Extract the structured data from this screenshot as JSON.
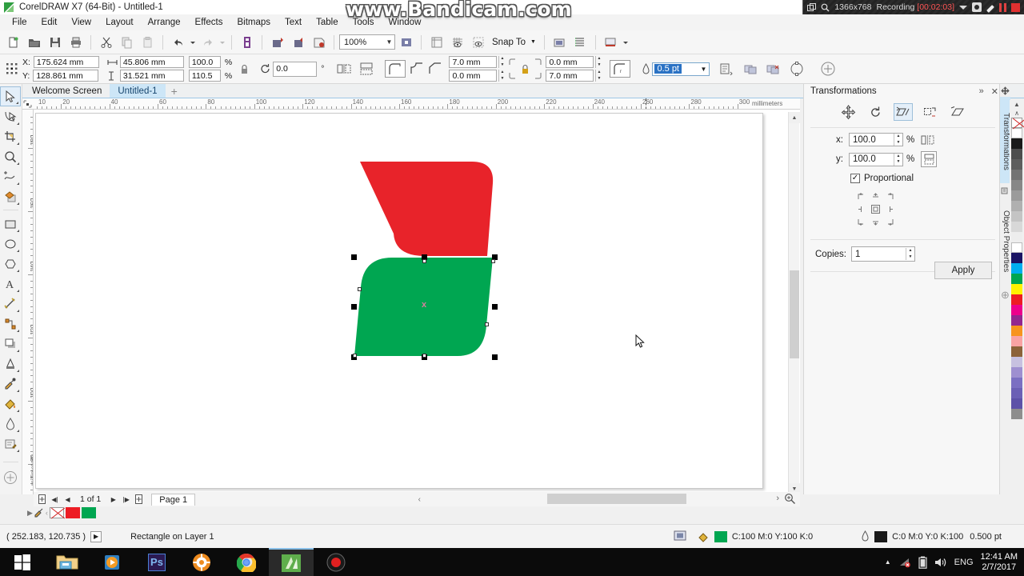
{
  "window": {
    "title": "CorelDRAW X7 (64-Bit) - Untitled-1",
    "app_icon": "coreldraw-icon"
  },
  "watermark": {
    "text": "www.Bandicam.com"
  },
  "recording_bar": {
    "resolution": "1366x768",
    "status_label": "Recording",
    "timer": "[00:02:03]",
    "icons": [
      "window-target-icon",
      "magnifier-icon",
      "caret-down-icon",
      "camera-icon",
      "pencil-icon",
      "pause-icon",
      "stop-icon"
    ]
  },
  "menu": {
    "items": [
      "File",
      "Edit",
      "View",
      "Layout",
      "Arrange",
      "Effects",
      "Bitmaps",
      "Text",
      "Table",
      "Tools",
      "Window"
    ]
  },
  "toolbar": {
    "zoom_level": "100%",
    "snap_to_label": "Snap To",
    "buttons": [
      "new-document-icon",
      "open-document-icon",
      "save-icon",
      "print-icon",
      "cut-icon",
      "copy-icon",
      "paste-icon",
      "undo-icon",
      "redo-icon",
      "import-icon",
      "export-icon",
      "publish-pdf-icon",
      "fullscreen-preview-icon",
      "show-rulers-icon",
      "show-grid-icon",
      "show-guides-icon",
      "options-icon",
      "object-manager-icon",
      "application-launcher-icon"
    ]
  },
  "property_bar": {
    "object_position_label_x": "X:",
    "object_position_label_y": "Y:",
    "x_value": "175.624 mm",
    "y_value": "128.861 mm",
    "width_value": "45.806 mm",
    "height_value": "31.521 mm",
    "scale_x": "100.0",
    "scale_y": "110.5",
    "percent_symbol": "%",
    "rotation_value": "0.0",
    "degree_symbol": "°",
    "corner_tl_value": "7.0 mm",
    "corner_bl_value": "0.0 mm",
    "corner_tr_value": "0.0 mm",
    "corner_br_value": "7.0 mm",
    "outline_width": "0.5 pt",
    "icons": [
      "object-origin-icon",
      "lock-ratio-icon",
      "rotation-icon",
      "mirror-horizontal-icon",
      "mirror-vertical-icon",
      "round-corner-icon",
      "scallop-corner-icon",
      "chamfer-corner-icon",
      "edit-corners-lock-icon",
      "relative-corner-icon",
      "outline-width-icon",
      "text-wrap-icon",
      "weld-icon",
      "trim-icon",
      "convert-to-curves-icon",
      "launch-icon"
    ]
  },
  "document_tabs": {
    "tabs": [
      {
        "label": "Welcome Screen",
        "active": false
      },
      {
        "label": "Untitled-1",
        "active": true
      }
    ],
    "add_label": "+"
  },
  "toolbox": {
    "tools": [
      {
        "name": "pick-tool-icon",
        "selected": true
      },
      {
        "name": "shape-tool-icon",
        "selected": false
      },
      {
        "name": "crop-tool-icon",
        "selected": false
      },
      {
        "name": "zoom-tool-icon",
        "selected": false
      },
      {
        "name": "freehand-tool-icon",
        "selected": false
      },
      {
        "name": "smart-fill-tool-icon",
        "selected": false
      },
      {
        "name": "rectangle-tool-icon",
        "selected": false
      },
      {
        "name": "ellipse-tool-icon",
        "selected": false
      },
      {
        "name": "polygon-tool-icon",
        "selected": false
      },
      {
        "name": "text-tool-icon",
        "selected": false
      },
      {
        "name": "parallel-dimension-tool-icon",
        "selected": false
      },
      {
        "name": "connector-tool-icon",
        "selected": false
      },
      {
        "name": "drop-shadow-tool-icon",
        "selected": false
      },
      {
        "name": "transparency-tool-icon",
        "selected": false
      },
      {
        "name": "color-eyedropper-tool-icon",
        "selected": false
      },
      {
        "name": "fill-tool-icon",
        "selected": false
      },
      {
        "name": "interactive-fill-tool-icon",
        "selected": false
      },
      {
        "name": "smart-drawing-tool-icon",
        "selected": false
      },
      {
        "name": "quick-customize-icon",
        "selected": false
      }
    ]
  },
  "rulers": {
    "unit_label": "millimeters",
    "horizontal_ticks": [
      "10",
      "60",
      "80",
      "100",
      "120",
      "140",
      "160",
      "180",
      "200",
      "220",
      "240",
      "260",
      "280"
    ],
    "vertical_ticks": [
      "180",
      "160",
      "140",
      "120",
      "100",
      "80"
    ]
  },
  "canvas": {
    "shapes": [
      {
        "name": "red-parallelogram",
        "fill": "#e8232a"
      },
      {
        "name": "green-parallelogram",
        "fill": "#00a651"
      }
    ],
    "selection": {
      "center_marker": "x"
    },
    "cursor": "arrow-pointer"
  },
  "page_nav": {
    "page_indicator": "1 of 1",
    "page_tab_label": "Page 1",
    "buttons": [
      "add-page-before-icon",
      "first-page-icon",
      "previous-page-icon",
      "next-page-icon",
      "last-page-icon",
      "add-page-after-icon"
    ]
  },
  "status_bar": {
    "coordinates": "( 252.183, 120.735 )",
    "object_info": "Rectangle on Layer 1",
    "fill_label": "C:100 M:0 Y:100 K:0",
    "fill_color": "#00a651",
    "outline_label": "C:0 M:0 Y:0 K:100",
    "outline_width": "0.500 pt",
    "outline_color": "#1a1a1a",
    "icons": [
      "color-proof-icon",
      "fill-icon",
      "outline-pen-icon"
    ]
  },
  "docker": {
    "title": "Transformations",
    "collapse_label": "»",
    "close_label": "✕",
    "tool_buttons": [
      {
        "name": "position-transform-icon",
        "selected": false
      },
      {
        "name": "rotate-transform-icon",
        "selected": false
      },
      {
        "name": "scale-mirror-transform-icon",
        "selected": true
      },
      {
        "name": "size-transform-icon",
        "selected": false
      },
      {
        "name": "skew-transform-icon",
        "selected": false
      }
    ],
    "x_label": "x:",
    "x_value": "100.0",
    "y_label": "y:",
    "y_value": "100.0",
    "percent": "%",
    "mirror_h_icon": "mirror-horizontal-icon",
    "mirror_v_icon": "mirror-vertical-icon",
    "proportional_label": "Proportional",
    "proportional_checked": true,
    "copies_label": "Copies:",
    "copies_value": "1",
    "apply_label": "Apply",
    "side_tabs": [
      {
        "label": "Transformations",
        "active": true
      },
      {
        "label": "Object Properties",
        "active": false
      }
    ]
  },
  "palette": {
    "colors": [
      "#ffffff",
      "#1a1a1a",
      "#4d4d4d",
      "#5e5e5e",
      "#737373",
      "#878787",
      "#9b9b9b",
      "#b0b0b0",
      "#c4c4c4",
      "#d8d8d8",
      "#ededed",
      "#ffffff",
      "#1b1464",
      "#00aeef",
      "#00a651",
      "#fff200",
      "#ed1c24",
      "#ec008c",
      "#92278f",
      "#f7941e",
      "#f9a3a3",
      "#8c6239",
      "#c7c1e0",
      "#9e8fd0",
      "#7b6fc2",
      "#6b60b5",
      "#5d52a8",
      "#8e8e8e"
    ]
  },
  "taskbar": {
    "items": [
      {
        "name": "start-button",
        "icon": "windows-logo-icon"
      },
      {
        "name": "file-explorer-button",
        "icon": "folder-icon"
      },
      {
        "name": "media-player-button",
        "icon": "media-player-icon"
      },
      {
        "name": "photoshop-button",
        "icon": "photoshop-icon",
        "label": "Ps"
      },
      {
        "name": "settings-button",
        "icon": "gear-orange-icon"
      },
      {
        "name": "chrome-button",
        "icon": "chrome-icon"
      },
      {
        "name": "coreldraw-button",
        "icon": "coreldraw-icon"
      },
      {
        "name": "bandicam-button",
        "icon": "bandicam-record-icon"
      }
    ],
    "tray": {
      "show_hidden": "▲",
      "network_icon": "network-error-icon",
      "battery_icon": "battery-icon",
      "volume_icon": "volume-icon",
      "language": "ENG",
      "time": "12:41 AM",
      "date": "2/7/2017"
    }
  }
}
